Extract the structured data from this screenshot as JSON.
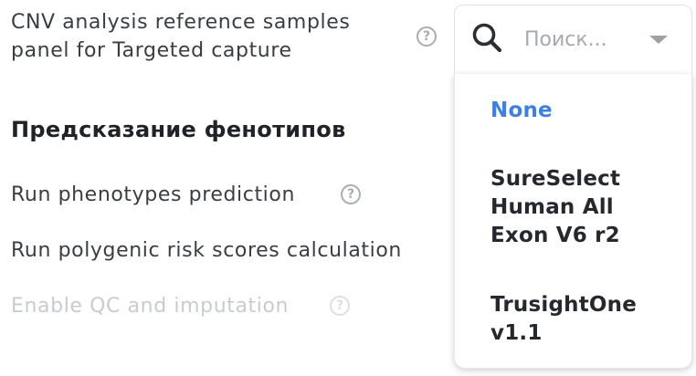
{
  "fields": {
    "cnv_reference": {
      "label_line1": "CNV analysis reference samples",
      "label_line2": "panel for Targeted capture",
      "help": "?"
    },
    "section_title": "Предсказание фенотипов",
    "run_phenotypes": {
      "label": "Run phenotypes prediction",
      "help": "?"
    },
    "run_prs": {
      "label": "Run polygenic risk scores calculation"
    },
    "enable_qc": {
      "label": "Enable QC and imputation",
      "help": "?"
    }
  },
  "select": {
    "placeholder": "Поиск...",
    "search_icon": "search-icon",
    "caret_icon": "chevron-down-icon",
    "options": [
      {
        "line1": "None",
        "selected": true
      },
      {
        "line1": "SureSelect",
        "line2": "Human All",
        "line3": "Exon V6 r2"
      },
      {
        "line1": "TrusightOne",
        "line2": "v1.1"
      }
    ]
  },
  "colors": {
    "accent": "#3f7fde",
    "text": "#3a3e42",
    "disabled_text": "#c9cccf",
    "placeholder": "#a6aaae"
  }
}
